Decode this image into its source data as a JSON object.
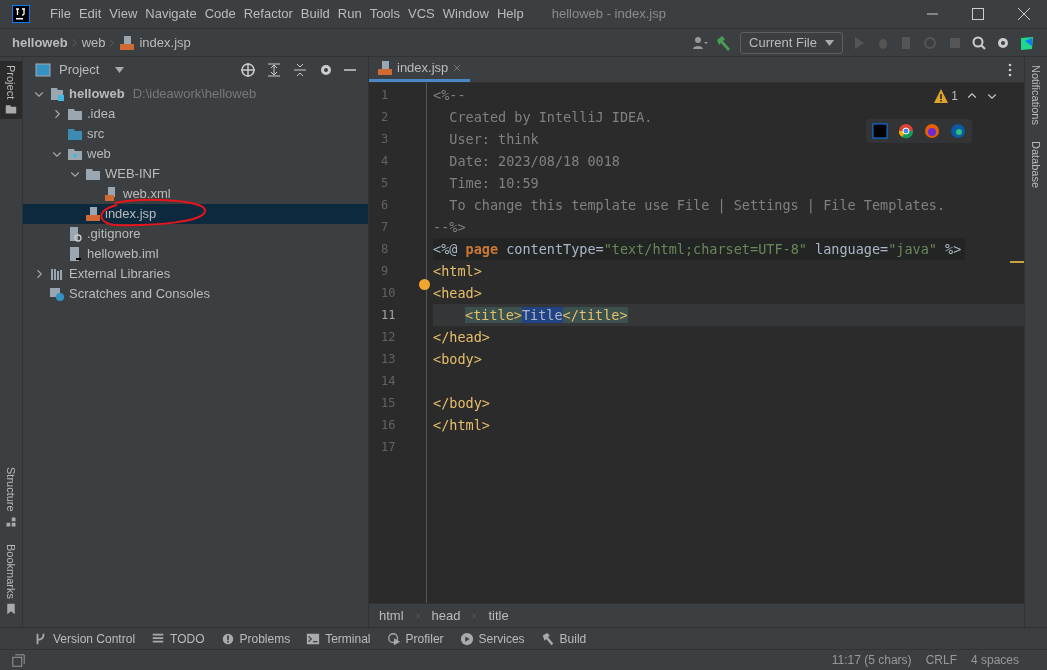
{
  "menu": [
    "File",
    "Edit",
    "View",
    "Navigate",
    "Code",
    "Refactor",
    "Build",
    "Run",
    "Tools",
    "VCS",
    "Window",
    "Help"
  ],
  "window": {
    "title": "helloweb - index.jsp"
  },
  "breadcrumbs": [
    "helloweb",
    "web",
    "index.jsp"
  ],
  "run_config": {
    "label": "Current File"
  },
  "project_panel": {
    "title": "Project",
    "tree": [
      {
        "label": "helloweb",
        "path": "D:\\ideawork\\helloweb",
        "kind": "module",
        "expanded": true,
        "selected": false,
        "children": [
          {
            "label": ".idea",
            "kind": "folder",
            "expanded": false,
            "selected": false
          },
          {
            "label": "src",
            "kind": "source-folder",
            "selected": false
          },
          {
            "label": "web",
            "kind": "web-folder",
            "expanded": true,
            "selected": false,
            "children": [
              {
                "label": "WEB-INF",
                "kind": "folder",
                "expanded": true,
                "selected": false,
                "children": [
                  {
                    "label": "web.xml",
                    "kind": "xml",
                    "selected": false
                  }
                ]
              },
              {
                "label": "index.jsp",
                "kind": "jsp",
                "selected": true
              }
            ]
          },
          {
            "label": ".gitignore",
            "kind": "ignore",
            "selected": false
          },
          {
            "label": "helloweb.iml",
            "kind": "iml",
            "selected": false
          }
        ]
      },
      {
        "label": "External Libraries",
        "kind": "libraries",
        "expanded": false,
        "selected": false
      },
      {
        "label": "Scratches and Consoles",
        "kind": "scratches",
        "selected": false
      }
    ]
  },
  "left_stripe": [
    "Project",
    "Structure",
    "Bookmarks"
  ],
  "right_stripe": [
    "Notifications",
    "Database"
  ],
  "editor_tab": {
    "label": "index.jsp"
  },
  "inspection": {
    "count": "1"
  },
  "code_lines": [
    {
      "number": "1",
      "current": false,
      "tokens": [
        {
          "kind": "comment",
          "text": "<%--"
        }
      ]
    },
    {
      "number": "2",
      "current": false,
      "tokens": [
        {
          "kind": "comment",
          "text": "  Created by IntelliJ IDEA."
        }
      ]
    },
    {
      "number": "3",
      "current": false,
      "tokens": [
        {
          "kind": "comment",
          "text": "  User: think"
        }
      ]
    },
    {
      "number": "4",
      "current": false,
      "tokens": [
        {
          "kind": "comment",
          "text": "  Date: 2023/08/18 0018"
        }
      ]
    },
    {
      "number": "5",
      "current": false,
      "tokens": [
        {
          "kind": "comment",
          "text": "  Time: 10:59"
        }
      ]
    },
    {
      "number": "6",
      "current": false,
      "tokens": [
        {
          "kind": "comment",
          "text": "  To change this template use File | Settings | File Templates."
        }
      ]
    },
    {
      "number": "7",
      "current": false,
      "tokens": [
        {
          "kind": "comment",
          "text": "--%>"
        }
      ]
    },
    {
      "number": "8",
      "current": false,
      "kind": "directive",
      "tokens": [
        {
          "kind": "plain",
          "text": "<%@ "
        },
        {
          "kind": "keyword",
          "text": "page"
        },
        {
          "kind": "plain",
          "text": " contentType="
        },
        {
          "kind": "string",
          "text": "\"text/html;charset=UTF-8\""
        },
        {
          "kind": "plain",
          "text": " language="
        },
        {
          "kind": "string",
          "text": "\"java\""
        },
        {
          "kind": "plain",
          "text": " %>"
        }
      ]
    },
    {
      "number": "9",
      "current": false,
      "tokens": [
        {
          "kind": "tag",
          "text": "<html>"
        }
      ]
    },
    {
      "number": "10",
      "current": false,
      "tokens": [
        {
          "kind": "tag",
          "text": "<head>"
        }
      ]
    },
    {
      "number": "11",
      "current": true,
      "kind": "nested",
      "tokens": [
        {
          "kind": "matched-tag",
          "text": "<title>"
        },
        {
          "kind": "selection",
          "text": "Title"
        },
        {
          "kind": "matched-tag",
          "text": "</title>"
        }
      ]
    },
    {
      "number": "12",
      "current": false,
      "tokens": [
        {
          "kind": "tag",
          "text": "</head>"
        }
      ]
    },
    {
      "number": "13",
      "current": false,
      "tokens": [
        {
          "kind": "tag",
          "text": "<body>"
        }
      ]
    },
    {
      "number": "14",
      "current": false
    },
    {
      "number": "15",
      "current": false,
      "tokens": [
        {
          "kind": "tag",
          "text": "</body>"
        }
      ]
    },
    {
      "number": "16",
      "current": false,
      "tokens": [
        {
          "kind": "tag",
          "text": "</html>"
        }
      ]
    },
    {
      "number": "17",
      "current": false
    }
  ],
  "editor_breadcrumbs": [
    "html",
    "head",
    "title"
  ],
  "tool_windows": [
    "Version Control",
    "TODO",
    "Problems",
    "Terminal",
    "Profiler",
    "Services",
    "Build"
  ],
  "status_bar": [
    "11:17 (5 chars)",
    "CRLF",
    "4 spaces"
  ]
}
